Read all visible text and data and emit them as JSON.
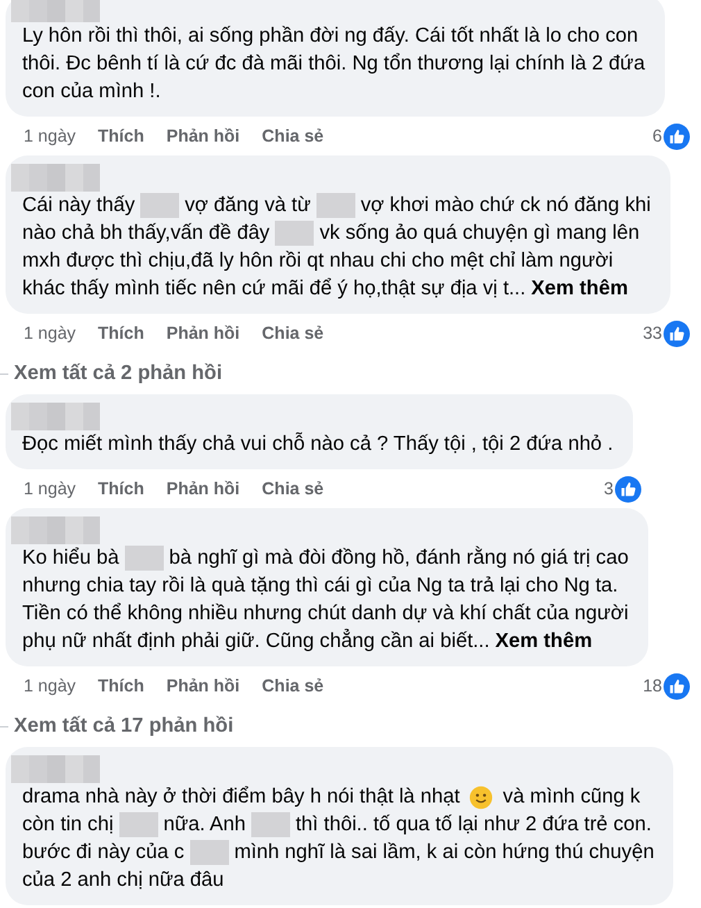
{
  "comments": [
    {
      "author_redacted": true,
      "lines": [
        [
          {
            "kind": "text",
            "text": "Ly hôn rồi thì thôi, ai sống phần đời ng đấy. Cái tốt nhất là lo cho con"
          }
        ],
        [
          {
            "kind": "text",
            "text": "thôi. Đc bênh tí là cứ đc đà mãi thôi. Ng tổn thương lại chính là 2 đứa"
          }
        ],
        [
          {
            "kind": "text",
            "text": "con của mình !."
          }
        ]
      ],
      "time": "1 ngày",
      "actions": [
        "Thích",
        "Phản hồi",
        "Chia sẻ"
      ],
      "likes": "6"
    },
    {
      "author_redacted": true,
      "lines": [
        [
          {
            "kind": "text",
            "text": "Cái này thấy"
          },
          {
            "kind": "redacted"
          },
          {
            "kind": "text",
            "text": "vợ đăng và từ"
          },
          {
            "kind": "redacted"
          },
          {
            "kind": "text",
            "text": "vợ khơi mào chứ ck nó đăng khi"
          }
        ],
        [
          {
            "kind": "text",
            "text": "nào chả bh thấy,vấn đề đây"
          },
          {
            "kind": "redacted"
          },
          {
            "kind": "text",
            "text": "vk sống ảo quá chuyện gì mang lên"
          }
        ],
        [
          {
            "kind": "text",
            "text": "mxh được thì chịu,đã ly hôn rồi qt nhau chi cho mệt chỉ làm người"
          }
        ],
        [
          {
            "kind": "text",
            "text": "khác thấy mình tiếc nên cứ mãi để ý họ,thật sự địa vị t..."
          },
          {
            "kind": "more",
            "text": "Xem thêm"
          }
        ]
      ],
      "time": "1 ngày",
      "actions": [
        "Thích",
        "Phản hồi",
        "Chia sẻ"
      ],
      "likes": "33",
      "replies": "Xem tất cả 2 phản hồi"
    },
    {
      "author_redacted": true,
      "lines": [
        [
          {
            "kind": "text",
            "text": "Đọc miết mình thấy chả vui chỗ nào cả ? Thấy tội , tội 2 đứa nhỏ ."
          }
        ]
      ],
      "time": "1 ngày",
      "actions": [
        "Thích",
        "Phản hồi",
        "Chia sẻ"
      ],
      "likes": "3"
    },
    {
      "author_redacted": true,
      "lines": [
        [
          {
            "kind": "text",
            "text": "Ko hiểu bà"
          },
          {
            "kind": "redacted"
          },
          {
            "kind": "text",
            "text": "bà nghĩ gì mà đòi đồng hồ, đánh rằng nó giá trị cao"
          }
        ],
        [
          {
            "kind": "text",
            "text": "nhưng chia tay rồi là quà tặng thì cái gì của Ng ta trả lại cho Ng ta."
          }
        ],
        [
          {
            "kind": "text",
            "text": "Tiền có thể không nhiều nhưng chút danh dự và khí chất của người"
          }
        ],
        [
          {
            "kind": "text",
            "text": "phụ nữ nhất định phải giữ. Cũng chẳng cần ai biết..."
          },
          {
            "kind": "more",
            "text": "Xem thêm"
          }
        ]
      ],
      "time": "1 ngày",
      "actions": [
        "Thích",
        "Phản hồi",
        "Chia sẻ"
      ],
      "likes": "18",
      "replies": "Xem tất cả 17 phản hồi"
    },
    {
      "author_redacted": true,
      "lines": [
        [
          {
            "kind": "text",
            "text": "drama nhà này ở thời điểm bây h nói thật là nhạt"
          },
          {
            "kind": "emoji"
          },
          {
            "kind": "text",
            "text": "và mình cũng k"
          }
        ],
        [
          {
            "kind": "text",
            "text": "còn tin chị"
          },
          {
            "kind": "redacted"
          },
          {
            "kind": "text",
            "text": "nữa. Anh"
          },
          {
            "kind": "redacted"
          },
          {
            "kind": "text",
            "text": "thì thôi.. tố qua tố lại như 2 đứa trẻ con."
          }
        ],
        [
          {
            "kind": "text",
            "text": "bước đi này của c"
          },
          {
            "kind": "redacted"
          },
          {
            "kind": "text",
            "text": "mình nghĩ là sai lầm, k ai còn hứng thú chuyện"
          }
        ],
        [
          {
            "kind": "text",
            "text": "của 2 anh chị nữa đâu"
          }
        ]
      ]
    }
  ]
}
